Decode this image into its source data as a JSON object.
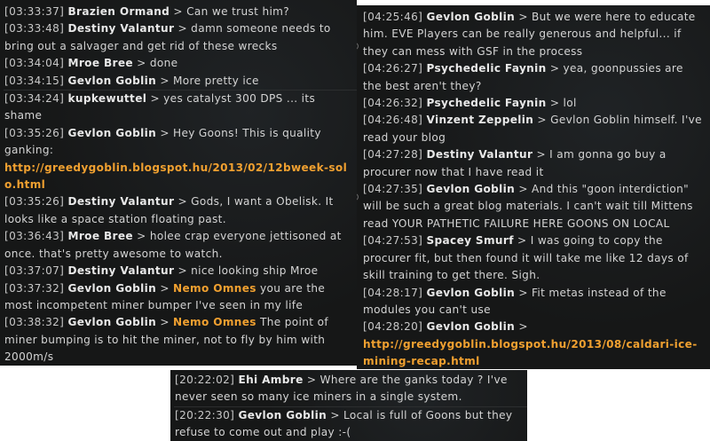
{
  "left": {
    "messages": [
      {
        "ts": "[03:33:37]",
        "name": "Brazien Ormand",
        "text": "Can we trust him?"
      },
      {
        "ts": "[03:33:48]",
        "name": "Destiny Valantur",
        "text": "damn someone needs to bring out a salvager and get rid of these wrecks"
      },
      {
        "ts": "[03:34:04]",
        "name": "Mroe Bree",
        "text": "done"
      },
      {
        "ts": "[03:34:15]",
        "name": "Gevlon Goblin",
        "text": "More pretty ice"
      },
      {
        "ts": "[03:34:24]",
        "name": "kupkewuttel",
        "text": "yes catalyst 300 DPS ... its shame"
      },
      {
        "ts": "[03:35:26]",
        "name": "Gevlon Goblin",
        "text": "Hey Goons! This is quality ganking:",
        "link": "http://greedygoblin.blogspot.hu/2013/02/12bweek-solo.html"
      },
      {
        "ts": "[03:35:26]",
        "name": "Destiny Valantur",
        "text": "Gods, I want a Obelisk.  It looks like a space station floating past."
      },
      {
        "ts": "[03:36:43]",
        "name": "Mroe Bree",
        "text": "holee crap everyone jettisoned at once.  that's pretty awesome to watch."
      },
      {
        "ts": "[03:37:07]",
        "name": "Destiny Valantur",
        "text": "nice looking ship Mroe"
      },
      {
        "ts": "[03:37:32]",
        "name": "Gevlon Goblin",
        "mention": "Nemo Omnes",
        "text": "you are the most incompetent miner bumper I've seen in my life"
      },
      {
        "ts": "[03:38:32]",
        "name": "Gevlon Goblin",
        "mention": "Nemo Omnes",
        "text": "The point of miner bumping is to hit the miner, not to fly by him with 2000m/s"
      }
    ]
  },
  "right": {
    "messages": [
      {
        "ts": "[04:25:46]",
        "name": "Gevlon Goblin",
        "text": "But we were here to educate him. EVE Players can be really generous and helpful... if they can mess with GSF in the process"
      },
      {
        "ts": "[04:26:27]",
        "name": "Psychedelic Faynin",
        "text": "yea, goonpussies are the best aren't they?"
      },
      {
        "ts": "[04:26:32]",
        "name": "Psychedelic Faynin",
        "text": "lol"
      },
      {
        "ts": "[04:26:48]",
        "name": "Vinzent Zeppelin",
        "text": "Gevlon Goblin himself. I've read your blog"
      },
      {
        "ts": "[04:27:28]",
        "name": "Destiny Valantur",
        "text": "I am gonna go buy a procurer now that I have read it"
      },
      {
        "ts": "[04:27:35]",
        "name": "Gevlon Goblin",
        "text": "And this \"goon interdiction\" will be such a great blog materials. I can't wait till Mittens read YOUR PATHETIC FAILURE HERE GOONS ON LOCAL"
      },
      {
        "ts": "[04:27:53]",
        "name": "Spacey Smurf",
        "text": "I was going to copy the procurer fit, but then found it will take me like 12 days of skill training to get there.  Sigh."
      },
      {
        "ts": "[04:28:17]",
        "name": "Gevlon Goblin",
        "text": "Fit metas instead of the modules you can't use"
      },
      {
        "ts": "[04:28:20]",
        "name": "Gevlon Goblin",
        "text": "",
        "link": "http://greedygoblin.blogspot.hu/2013/08/caldari-ice-mining-recap.html"
      }
    ]
  },
  "bottom": {
    "messages": [
      {
        "ts": "[20:22:02]",
        "name": "Ehi Ambre",
        "text": "Where are the ganks today ? I've never seen so many ice miners in a single system."
      },
      {
        "ts": "[20:22:30]",
        "name": "Gevlon Goblin",
        "text": "Local is full of Goons but they refuse to come out and play :-("
      }
    ]
  },
  "separator": ">",
  "colors": {
    "background": "#161717",
    "text": "#d4d4d4",
    "highlight": "#f0a030"
  }
}
